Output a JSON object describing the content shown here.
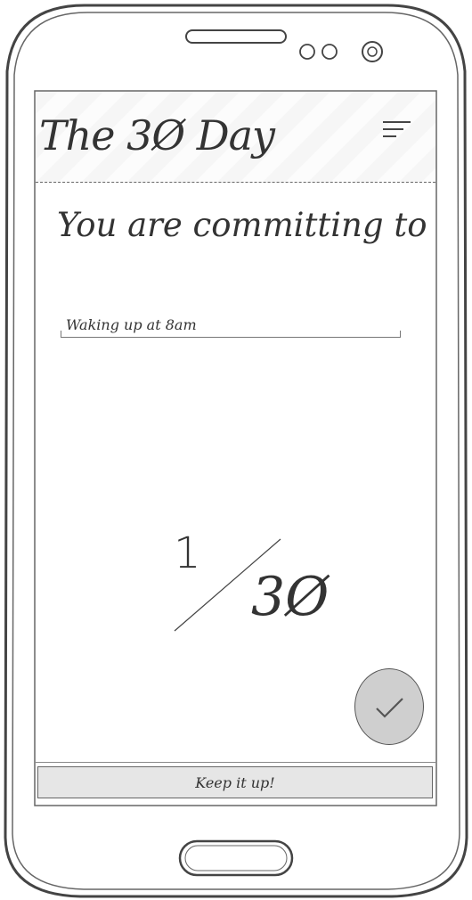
{
  "app_bar": {
    "title": "The 3Ø Day",
    "menu_icon": "menu-lines-icon"
  },
  "main": {
    "heading": "You are committing to",
    "commitment_value": "Waking up at 8am"
  },
  "progress": {
    "current": "1",
    "total": "3Ø"
  },
  "fab": {
    "icon": "checkmark-icon"
  },
  "footer": {
    "button_label": "Keep it up!"
  }
}
